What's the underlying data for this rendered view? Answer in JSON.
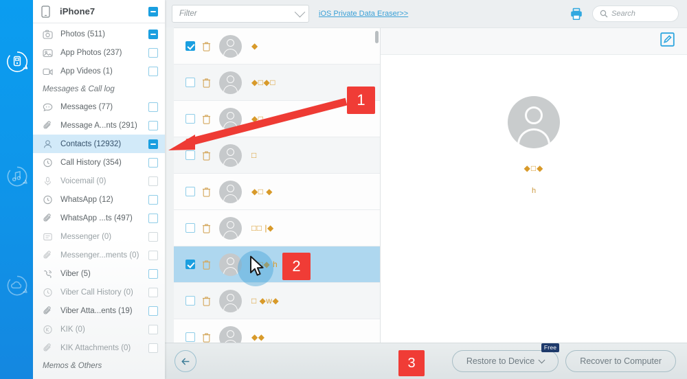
{
  "rail": {
    "items": [
      {
        "name": "recover-from-ios-device",
        "icon": "device-refresh-icon",
        "active": true
      },
      {
        "name": "recover-music",
        "icon": "music-refresh-icon",
        "active": false
      },
      {
        "name": "recover-from-icloud",
        "icon": "cloud-refresh-icon",
        "active": false
      }
    ]
  },
  "sidebar": {
    "device": {
      "title": "iPhone7",
      "icon": "phone-icon",
      "checkbox": "indeterminate"
    },
    "items": [
      {
        "label": "Photos (511)",
        "icon": "camera-icon",
        "checkbox": "indeterminate",
        "state": "normal"
      },
      {
        "label": "App Photos (237)",
        "icon": "image-icon",
        "checkbox": "unchecked",
        "state": "normal"
      },
      {
        "label": "App Videos (1)",
        "icon": "video-icon",
        "checkbox": "unchecked",
        "state": "normal"
      },
      {
        "label": "Messages & Call log",
        "icon": "",
        "checkbox": "",
        "state": "group"
      },
      {
        "label": "Messages (77)",
        "icon": "chat-icon",
        "checkbox": "unchecked",
        "state": "normal"
      },
      {
        "label": "Message A...nts (291)",
        "icon": "paperclip-icon",
        "checkbox": "unchecked",
        "state": "normal"
      },
      {
        "label": "Contacts (12932)",
        "icon": "person-icon",
        "checkbox": "indeterminate",
        "state": "active"
      },
      {
        "label": "Call History (354)",
        "icon": "clock-icon",
        "checkbox": "unchecked",
        "state": "normal"
      },
      {
        "label": "Voicemail (0)",
        "icon": "microphone-icon",
        "checkbox": "disabled",
        "state": "dim"
      },
      {
        "label": "WhatsApp (12)",
        "icon": "whatsapp-icon",
        "checkbox": "unchecked",
        "state": "normal"
      },
      {
        "label": "WhatsApp ...ts (497)",
        "icon": "paperclip-icon",
        "checkbox": "unchecked",
        "state": "normal"
      },
      {
        "label": "Messenger (0)",
        "icon": "messenger-icon",
        "checkbox": "disabled",
        "state": "dim"
      },
      {
        "label": "Messenger...ments (0)",
        "icon": "paperclip-icon",
        "checkbox": "disabled",
        "state": "dim"
      },
      {
        "label": "Viber (5)",
        "icon": "viber-icon",
        "checkbox": "unchecked",
        "state": "normal"
      },
      {
        "label": "Viber Call History (0)",
        "icon": "clock-icon",
        "checkbox": "disabled",
        "state": "dim"
      },
      {
        "label": "Viber Atta...ents (19)",
        "icon": "paperclip-icon",
        "checkbox": "unchecked",
        "state": "normal"
      },
      {
        "label": "KIK (0)",
        "icon": "kik-icon",
        "checkbox": "disabled",
        "state": "dim"
      },
      {
        "label": "KIK Attachments (0)",
        "icon": "paperclip-icon",
        "checkbox": "disabled",
        "state": "dim"
      },
      {
        "label": "Memos & Others",
        "icon": "",
        "checkbox": "",
        "state": "group"
      }
    ]
  },
  "toolbar": {
    "filter_value": "",
    "filter_placeholder": "Filter",
    "eraser_link": "iOS Private Data Eraser>>",
    "print_icon": "printer-icon",
    "search_placeholder": "Search",
    "search_value": ""
  },
  "contact_list": {
    "rows": [
      {
        "name": "◆",
        "checked": true,
        "selected": false
      },
      {
        "name": "◆□◆□",
        "checked": false,
        "selected": false
      },
      {
        "name": "◆□",
        "checked": false,
        "selected": false
      },
      {
        "name": "□",
        "checked": false,
        "selected": false
      },
      {
        "name": "◆□ ◆",
        "checked": false,
        "selected": false
      },
      {
        "name": "□□ |◆",
        "checked": false,
        "selected": false
      },
      {
        "name": "◆□◆ h",
        "checked": true,
        "selected": true
      },
      {
        "name": "□ ◆w◆",
        "checked": false,
        "selected": false
      },
      {
        "name": "◆◆",
        "checked": false,
        "selected": false
      }
    ]
  },
  "detail": {
    "edit_icon": "edit-square-icon",
    "avatar": "person-avatar",
    "name": "◆□◆",
    "subtitle": "h"
  },
  "bottombar": {
    "back_icon": "arrow-left-icon",
    "restore_label": "Restore to Device",
    "restore_badge": "Free",
    "recover_label": "Recover to Computer"
  },
  "annotations": {
    "step1": "1",
    "step2": "2",
    "step3": "3"
  },
  "colors": {
    "accent_blue": "#1a9fe0",
    "rail_blue": "#0b9df0",
    "annotation_red": "#f03c36",
    "contact_name_gold": "#d89a2a",
    "selected_row_blue": "#aed7ef",
    "sidebar_active_blue": "#d2eaf9",
    "free_badge_navy": "#1e3a6b"
  }
}
